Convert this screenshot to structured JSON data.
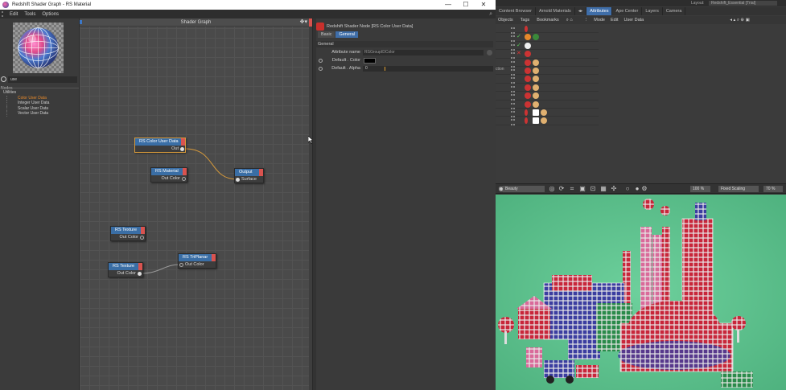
{
  "window": {
    "title": "Redshift Shader Graph - RS Material",
    "minimize": "—",
    "maximize": "☐",
    "close": "✕"
  },
  "menu": {
    "items": [
      "Edit",
      "Tools",
      "Options"
    ]
  },
  "search": {
    "value": "use"
  },
  "nodes_panel": {
    "title": "Nodes",
    "root": "Utilities",
    "items": [
      "Color User Data",
      "Integer User Data",
      "Scalar User Data",
      "Vector User Data"
    ],
    "active_index": 0
  },
  "graph": {
    "title": "Shader Graph",
    "nodes": [
      {
        "title": "RS Color User Data",
        "port": "Out"
      },
      {
        "title": "RS Material",
        "port": "Out Color"
      },
      {
        "title": "Output",
        "port": "Surface"
      },
      {
        "title": "RS Texture",
        "port": "Out Color"
      },
      {
        "title": "RS Texture",
        "port": "Out Color"
      },
      {
        "title": "RS TriPlanar",
        "port": "Out Color"
      }
    ]
  },
  "properties": {
    "header": "Redshift Shader Node [RS Color User Data]",
    "tabs": [
      "Basic",
      "General"
    ],
    "active_tab": "General",
    "section": "General",
    "attribute_name_label": "Attribute name",
    "attribute_name_value": "RSGroupIDColor",
    "default_color_label": "Default . Color",
    "default_color_value": "#000000",
    "default_alpha_label": "Default . Alpha",
    "default_alpha_value": "0"
  },
  "c4d": {
    "layout_label": "Layout:",
    "layout_value": "Redshift_Essential [Trial]",
    "tabs": [
      "Content Browser",
      "Arnold Materials",
      "Attributes",
      "Ape Center",
      "Layers",
      "Camera"
    ],
    "active_tab": "Attributes",
    "obj_menu": [
      "Objects",
      "Tags",
      "Bookmarks"
    ],
    "attr_menu": [
      "Mode",
      "Edit",
      "User Data"
    ],
    "obj_clips": [
      "ction"
    ],
    "render_mode": "Beauty",
    "zoom_value": "100 %",
    "scaling_mode": "Fixed Scaling",
    "scale_value": "70 %"
  },
  "colors": {
    "accent": "#3f6ea9",
    "node_header": "#3a6ea5",
    "node_close": "#d9534f",
    "active_item": "#e6892b",
    "wire": "#d79a3b",
    "render_bg": "#5ec38f"
  }
}
